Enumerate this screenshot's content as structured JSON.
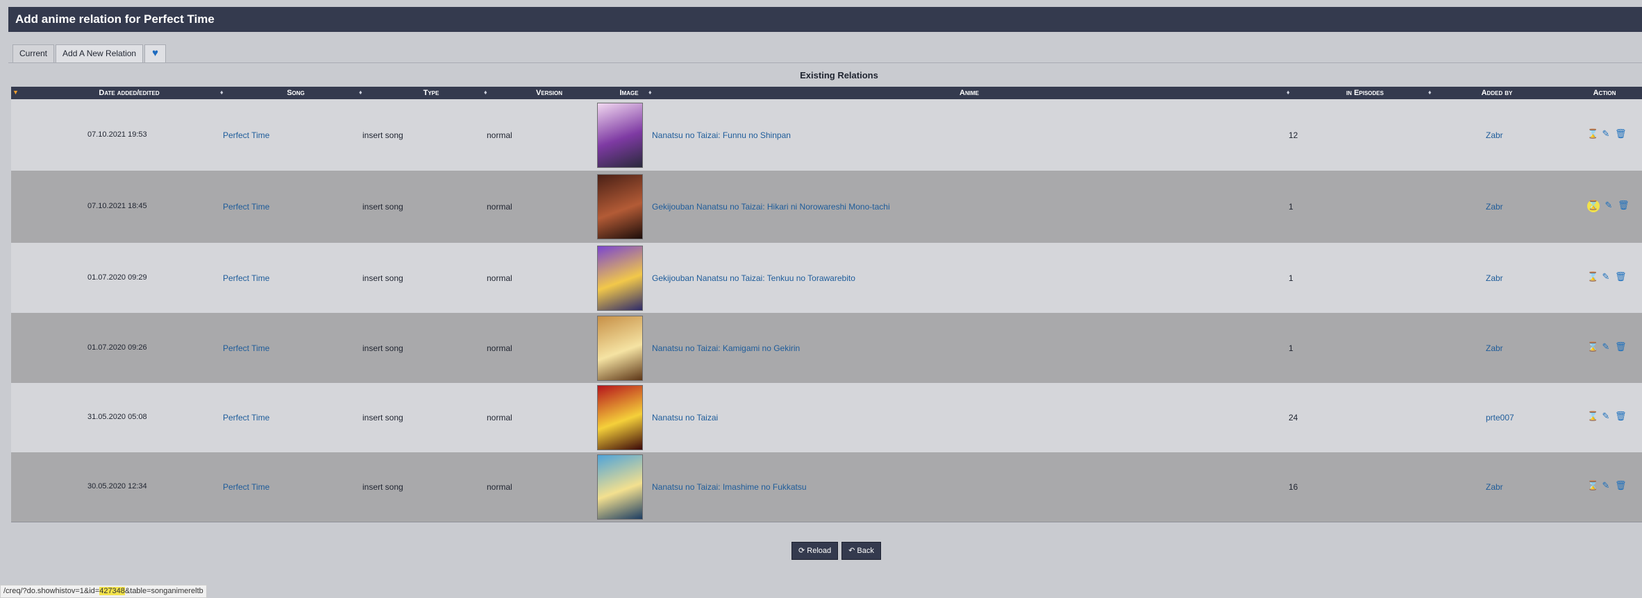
{
  "header": {
    "title": "Add anime relation for Perfect Time"
  },
  "tabs": [
    {
      "label": "Current"
    },
    {
      "label": "Add A New Relation"
    },
    {
      "label": ""
    }
  ],
  "table": {
    "caption": "Existing Relations",
    "columns": {
      "date": "Date added/edited",
      "song": "Song",
      "type": "Type",
      "version": "Version",
      "image": "Image",
      "anime": "Anime",
      "episodes": "in Episodes",
      "added_by": "Added by",
      "action": "Action"
    },
    "rows": [
      {
        "date": "07.10.2021 19:53",
        "song": "Perfect Time",
        "type": "insert song",
        "version": "normal",
        "anime": "Nanatsu no Taizai: Funnu no Shinpan",
        "episodes": "12",
        "added_by": "Zabr"
      },
      {
        "date": "07.10.2021 18:45",
        "song": "Perfect Time",
        "type": "insert song",
        "version": "normal",
        "anime": "Gekijouban Nanatsu no Taizai: Hikari ni Norowareshi Mono-tachi",
        "episodes": "1",
        "added_by": "Zabr"
      },
      {
        "date": "01.07.2020 09:29",
        "song": "Perfect Time",
        "type": "insert song",
        "version": "normal",
        "anime": "Gekijouban Nanatsu no Taizai: Tenkuu no Torawarebito",
        "episodes": "1",
        "added_by": "Zabr"
      },
      {
        "date": "01.07.2020 09:26",
        "song": "Perfect Time",
        "type": "insert song",
        "version": "normal",
        "anime": "Nanatsu no Taizai: Kamigami no Gekirin",
        "episodes": "1",
        "added_by": "Zabr"
      },
      {
        "date": "31.05.2020 05:08",
        "song": "Perfect Time",
        "type": "insert song",
        "version": "normal",
        "anime": "Nanatsu no Taizai",
        "episodes": "24",
        "added_by": "prte007"
      },
      {
        "date": "30.05.2020 12:34",
        "song": "Perfect Time",
        "type": "insert song",
        "version": "normal",
        "anime": "Nanatsu no Taizai: Imashime no Fukkatsu",
        "episodes": "16",
        "added_by": "Zabr"
      }
    ]
  },
  "buttons": {
    "reload": "Reload",
    "back": "Back"
  },
  "status_bar": {
    "prefix": "/creq/?do.showhistov=1&id=",
    "id": "427348",
    "suffix": "&table=songanimereltb"
  },
  "colors": {
    "header_bg": "#343a4e",
    "link": "#1e5c9a",
    "icon": "#1b6fbd",
    "highlight": "#f2e24b"
  },
  "icons": {
    "sort": "sort-icon",
    "history": "hourglass-icon",
    "edit": "edit-icon",
    "delete": "trash-icon",
    "heart": "heart-icon",
    "reload": "refresh-icon",
    "back": "back-arrow-icon"
  }
}
